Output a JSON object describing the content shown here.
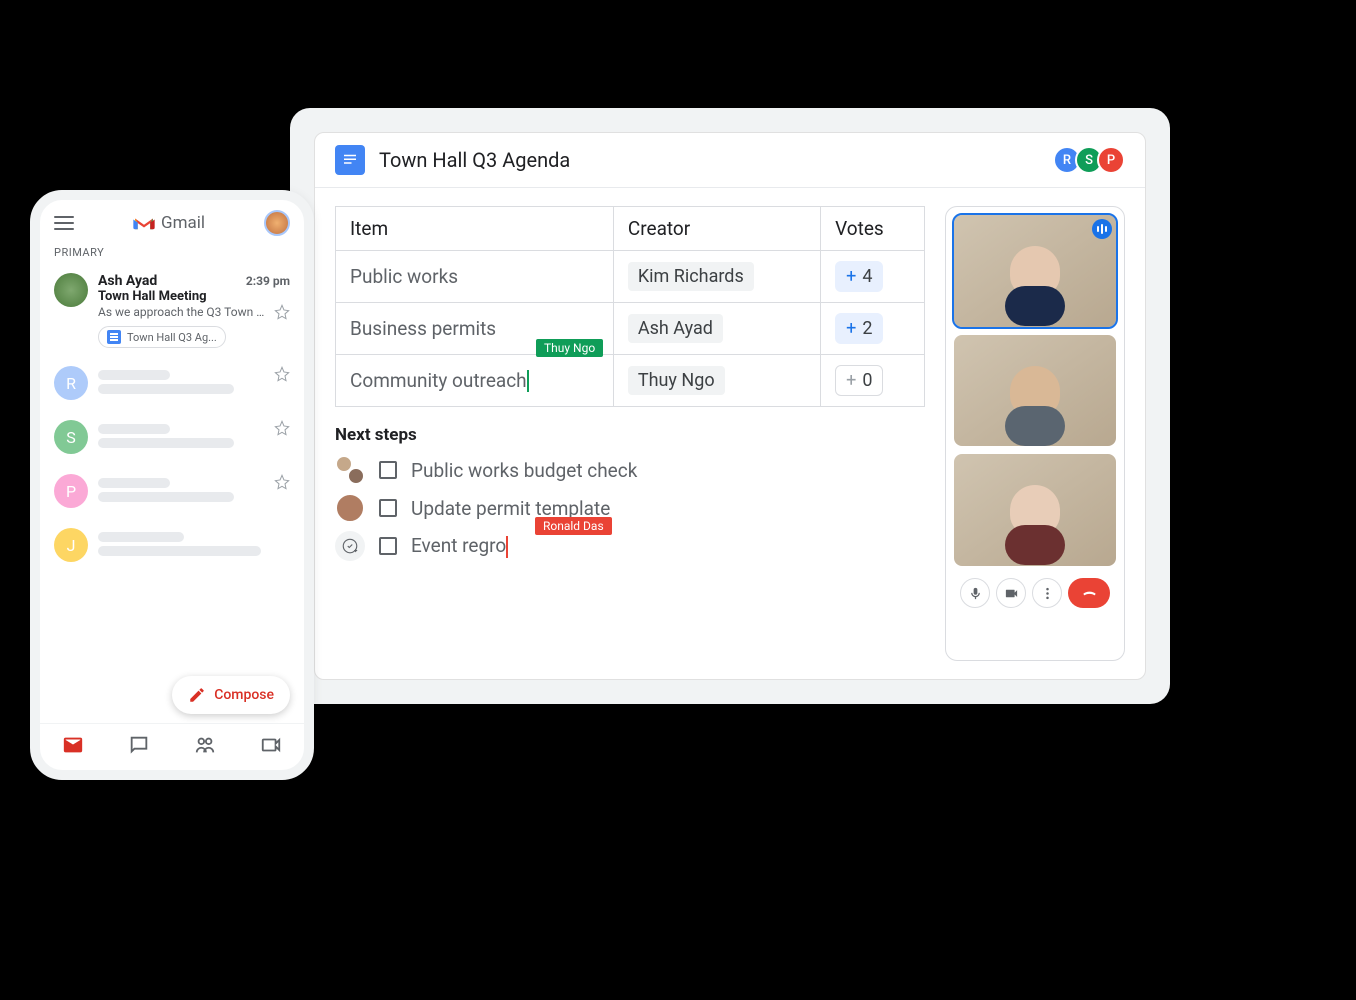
{
  "doc": {
    "title": "Town Hall Q3 Agenda",
    "collaborators": [
      {
        "initial": "R",
        "color": "#4285f4"
      },
      {
        "initial": "S",
        "color": "#0f9d58"
      },
      {
        "initial": "P",
        "color": "#ea4335"
      }
    ],
    "table": {
      "headers": {
        "item": "Item",
        "creator": "Creator",
        "votes": "Votes"
      },
      "rows": [
        {
          "item": "Public works",
          "creator": "Kim Richards",
          "votes": 4,
          "vote_active": true
        },
        {
          "item": "Business permits",
          "creator": "Ash Ayad",
          "votes": 2,
          "vote_active": true
        },
        {
          "item": "Community outreach",
          "creator": "Thuy Ngo",
          "votes": 0,
          "vote_active": false
        }
      ]
    },
    "cursors": {
      "green": "Thuy Ngo",
      "red": "Ronald Das"
    },
    "next_steps": {
      "heading": "Next steps",
      "items": [
        {
          "text": "Public works budget check"
        },
        {
          "text": "Update permit template"
        },
        {
          "text": "Event regro"
        }
      ]
    }
  },
  "meet": {
    "participants": 3,
    "speaking_index": 0
  },
  "gmail": {
    "brand": "Gmail",
    "tab": "PRIMARY",
    "top_email": {
      "sender": "Ash Ayad",
      "time": "2:39 pm",
      "subject": "Town Hall Meeting",
      "preview": "As we approach the Q3 Town Ha...",
      "attachment": "Town Hall Q3 Ag..."
    },
    "compose_label": "Compose",
    "skeleton_initials": [
      "R",
      "S",
      "P",
      "J"
    ]
  }
}
